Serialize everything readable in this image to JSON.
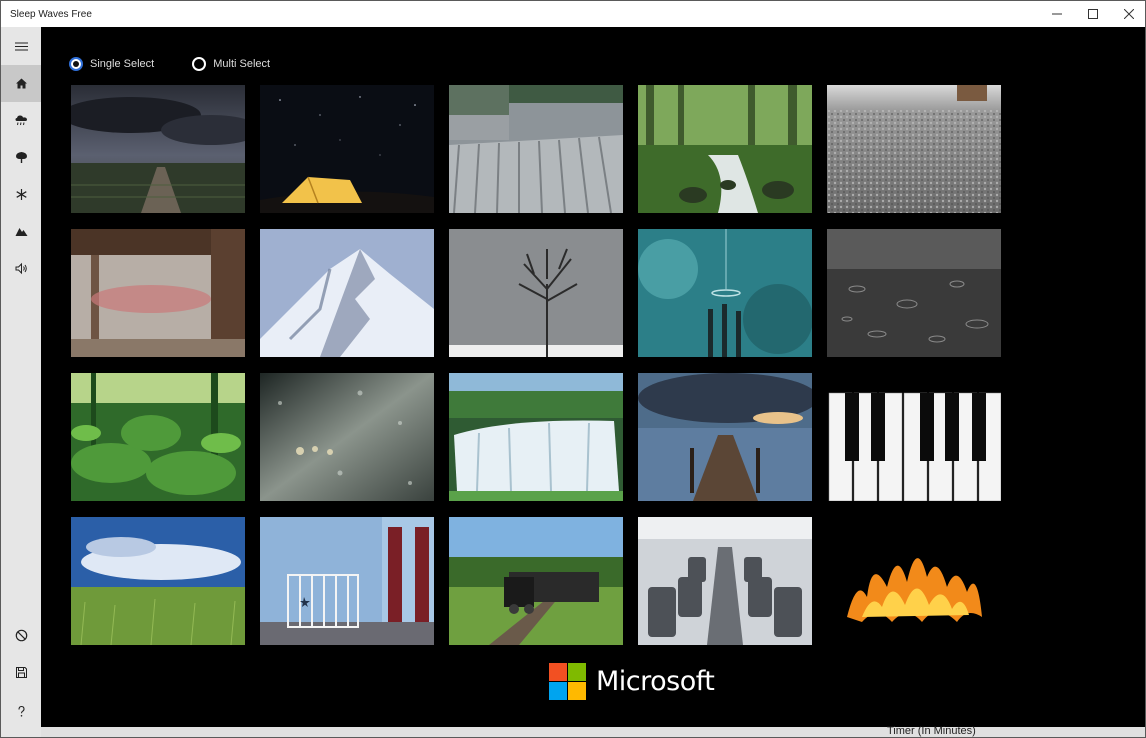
{
  "window": {
    "title": "Sleep Waves Free"
  },
  "sidebar": {
    "items": [
      {
        "icon": "hamburger-icon"
      },
      {
        "icon": "home-icon"
      },
      {
        "icon": "rain-cloud-icon"
      },
      {
        "icon": "tree-icon"
      },
      {
        "icon": "snowflake-icon"
      },
      {
        "icon": "mountain-icon"
      },
      {
        "icon": "speaker-icon"
      },
      {
        "icon": "no-sign-icon"
      },
      {
        "icon": "save-icon"
      },
      {
        "icon": "help-icon"
      }
    ]
  },
  "selection": {
    "single_label": "Single Select",
    "multi_label": "Multi Select",
    "selected": "single"
  },
  "sounds": [
    {
      "name": "stormy-field"
    },
    {
      "name": "night-camping"
    },
    {
      "name": "rain-on-roof"
    },
    {
      "name": "forest-stream"
    },
    {
      "name": "gravel-rain"
    },
    {
      "name": "porch-rain"
    },
    {
      "name": "snow-mountain"
    },
    {
      "name": "winter-tree"
    },
    {
      "name": "wind-chimes"
    },
    {
      "name": "rain-puddle"
    },
    {
      "name": "jungle"
    },
    {
      "name": "window-rain"
    },
    {
      "name": "waterfall"
    },
    {
      "name": "lake-pier"
    },
    {
      "name": "piano"
    },
    {
      "name": "grassland-sky"
    },
    {
      "name": "nursery"
    },
    {
      "name": "steam-train"
    },
    {
      "name": "airplane-cabin"
    },
    {
      "name": "fireplace"
    }
  ],
  "brand": {
    "text": "Microsoft",
    "colors": [
      "#f25022",
      "#7fba00",
      "#00a4ef",
      "#ffb900"
    ]
  },
  "footer": {
    "timer_label": "Timer (In Minutes)"
  }
}
